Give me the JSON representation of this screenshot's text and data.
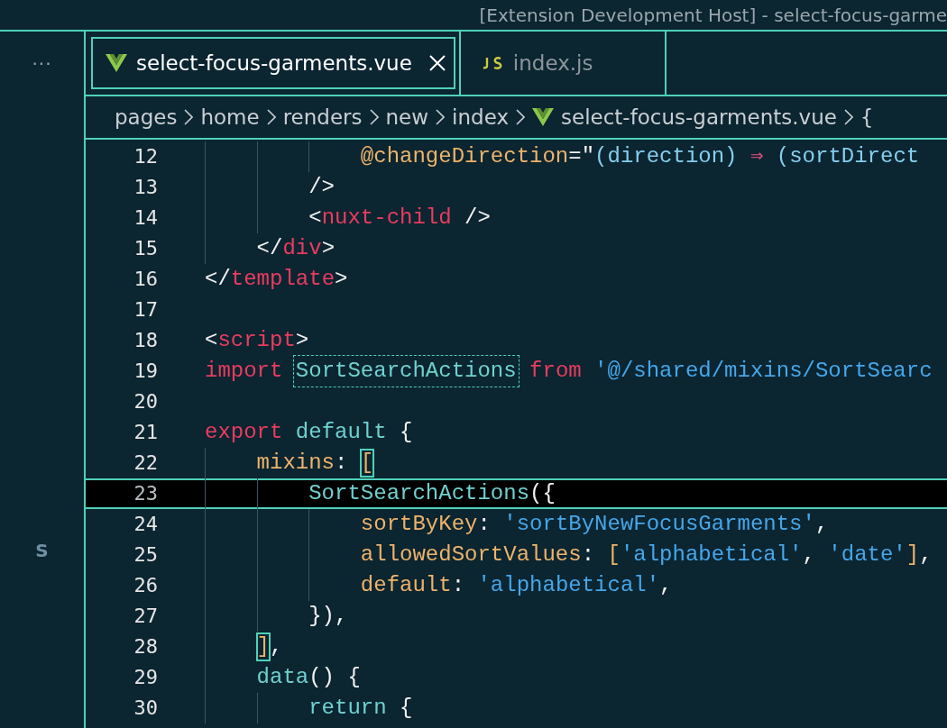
{
  "window": {
    "title": "[Extension Development Host] - select-focus-garme"
  },
  "activity_bar": {
    "more": "···",
    "account": "S"
  },
  "tabs": [
    {
      "label": "select-focus-garments.vue",
      "kind": "vue",
      "selected": true
    },
    {
      "label": "index.js",
      "kind": "js",
      "selected": false
    }
  ],
  "breadcrumbs": [
    {
      "label": "pages",
      "kind": "folder"
    },
    {
      "label": "home",
      "kind": "folder"
    },
    {
      "label": "renders",
      "kind": "folder"
    },
    {
      "label": "new",
      "kind": "folder"
    },
    {
      "label": "index",
      "kind": "folder"
    },
    {
      "label": "select-focus-garments.vue",
      "kind": "vue"
    },
    {
      "label": "{",
      "kind": "symbol"
    }
  ],
  "editor": {
    "lines": [
      {
        "number": "12",
        "selected": false,
        "tokens": [
          {
            "text": "            @changeDirection",
            "kind": "attr"
          },
          {
            "text": "=\"",
            "kind": "punct"
          },
          {
            "text": "(direction) ",
            "kind": "param"
          },
          {
            "text": "⇒",
            "kind": "arrow"
          },
          {
            "text": " (sortDirect",
            "kind": "param"
          }
        ]
      },
      {
        "number": "13",
        "selected": false,
        "tokens": [
          {
            "text": "        />",
            "kind": "punct"
          }
        ]
      },
      {
        "number": "14",
        "selected": false,
        "tokens": [
          {
            "text": "        <",
            "kind": "punct"
          },
          {
            "text": "nuxt-child",
            "kind": "tag"
          },
          {
            "text": " />",
            "kind": "punct"
          }
        ]
      },
      {
        "number": "15",
        "selected": false,
        "tokens": [
          {
            "text": "    </",
            "kind": "punct"
          },
          {
            "text": "div",
            "kind": "tag"
          },
          {
            "text": ">",
            "kind": "punct"
          }
        ]
      },
      {
        "number": "16",
        "selected": false,
        "tokens": [
          {
            "text": "</",
            "kind": "punct"
          },
          {
            "text": "template",
            "kind": "tag"
          },
          {
            "text": ">",
            "kind": "punct"
          }
        ]
      },
      {
        "number": "17",
        "selected": false
      },
      {
        "number": "18",
        "selected": false,
        "tokens": [
          {
            "text": "<",
            "kind": "punct"
          },
          {
            "text": "script",
            "kind": "tag"
          },
          {
            "text": ">",
            "kind": "punct"
          }
        ]
      },
      {
        "number": "19",
        "selected": false,
        "tokens": [
          {
            "text": "import ",
            "kind": "keyword"
          },
          {
            "text": "SortSearchActions",
            "kind": "match"
          },
          {
            "text": " from",
            "kind": "keyword"
          },
          {
            "text": " '@/shared/mixins/SortSearc",
            "kind": "string"
          }
        ]
      },
      {
        "number": "20",
        "selected": false
      },
      {
        "number": "21",
        "selected": false,
        "tokens": [
          {
            "text": "export",
            "kind": "keyword"
          },
          {
            "text": " default",
            "kind": "name"
          },
          {
            "text": " {",
            "kind": "punct"
          }
        ]
      },
      {
        "number": "22",
        "selected": false,
        "tokens": [
          {
            "text": "    mixins",
            "kind": "attr"
          },
          {
            "text": ": ",
            "kind": "punct"
          },
          {
            "text": "[",
            "kind": "bracket"
          }
        ]
      },
      {
        "number": "23",
        "selected": true,
        "tokens": [
          {
            "text": "        SortSearchActions",
            "kind": "name"
          },
          {
            "text": "({",
            "kind": "punct"
          }
        ]
      },
      {
        "number": "24",
        "selected": false,
        "tokens": [
          {
            "text": "            sortByKey",
            "kind": "attr"
          },
          {
            "text": ": ",
            "kind": "punct"
          },
          {
            "text": "'sortByNewFocusGarments'",
            "kind": "string"
          },
          {
            "text": ",",
            "kind": "punct"
          }
        ]
      },
      {
        "number": "25",
        "selected": false,
        "tokens": [
          {
            "text": "            allowedSortValues",
            "kind": "attr"
          },
          {
            "text": ": ",
            "kind": "punct"
          },
          {
            "text": "[",
            "kind": "attr"
          },
          {
            "text": "'alphabetical'",
            "kind": "string"
          },
          {
            "text": ", ",
            "kind": "punct"
          },
          {
            "text": "'date'",
            "kind": "string"
          },
          {
            "text": "]",
            "kind": "attr"
          },
          {
            "text": ",",
            "kind": "punct"
          }
        ]
      },
      {
        "number": "26",
        "selected": false,
        "tokens": [
          {
            "text": "            default",
            "kind": "attr"
          },
          {
            "text": ": ",
            "kind": "punct"
          },
          {
            "text": "'alphabetical'",
            "kind": "string"
          },
          {
            "text": ",",
            "kind": "punct"
          }
        ]
      },
      {
        "number": "27",
        "selected": false,
        "tokens": [
          {
            "text": "        }),",
            "kind": "punct"
          }
        ]
      },
      {
        "number": "28",
        "selected": false,
        "tokens": [
          {
            "text": "    ]",
            "kind": "bracket"
          },
          {
            "text": ",",
            "kind": "punct"
          }
        ]
      },
      {
        "number": "29",
        "selected": false,
        "tokens": [
          {
            "text": "    data",
            "kind": "name"
          },
          {
            "text": "() {",
            "kind": "punct"
          }
        ]
      },
      {
        "number": "30",
        "selected": false,
        "tokens": [
          {
            "text": "        return",
            "kind": "name"
          },
          {
            "text": " {",
            "kind": "punct"
          }
        ]
      }
    ]
  }
}
